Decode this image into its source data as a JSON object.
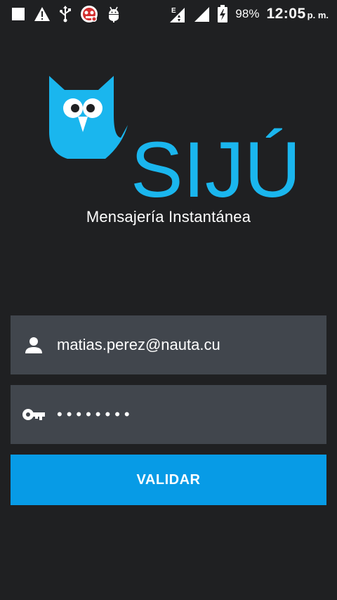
{
  "status_bar": {
    "left_icons": [
      "stop-square-icon",
      "warning-icon",
      "usb-icon",
      "app-notification-icon",
      "android-debug-icon"
    ],
    "right_icons": [
      "signal-e-icon",
      "signal-icon",
      "battery-charging-icon"
    ],
    "battery": "98%",
    "time": "12:05",
    "ampm": "p. m."
  },
  "logo": {
    "brand": "SIJÚ",
    "tagline": "Mensajería Instantánea",
    "brand_color": "#1ab6ee"
  },
  "form": {
    "email_value": "matias.perez@nauta.cu",
    "password_mask": "••••••••",
    "validate_label": "VALIDAR"
  },
  "colors": {
    "background": "#1f2022",
    "field_background": "#41464d",
    "button": "#079be6"
  }
}
